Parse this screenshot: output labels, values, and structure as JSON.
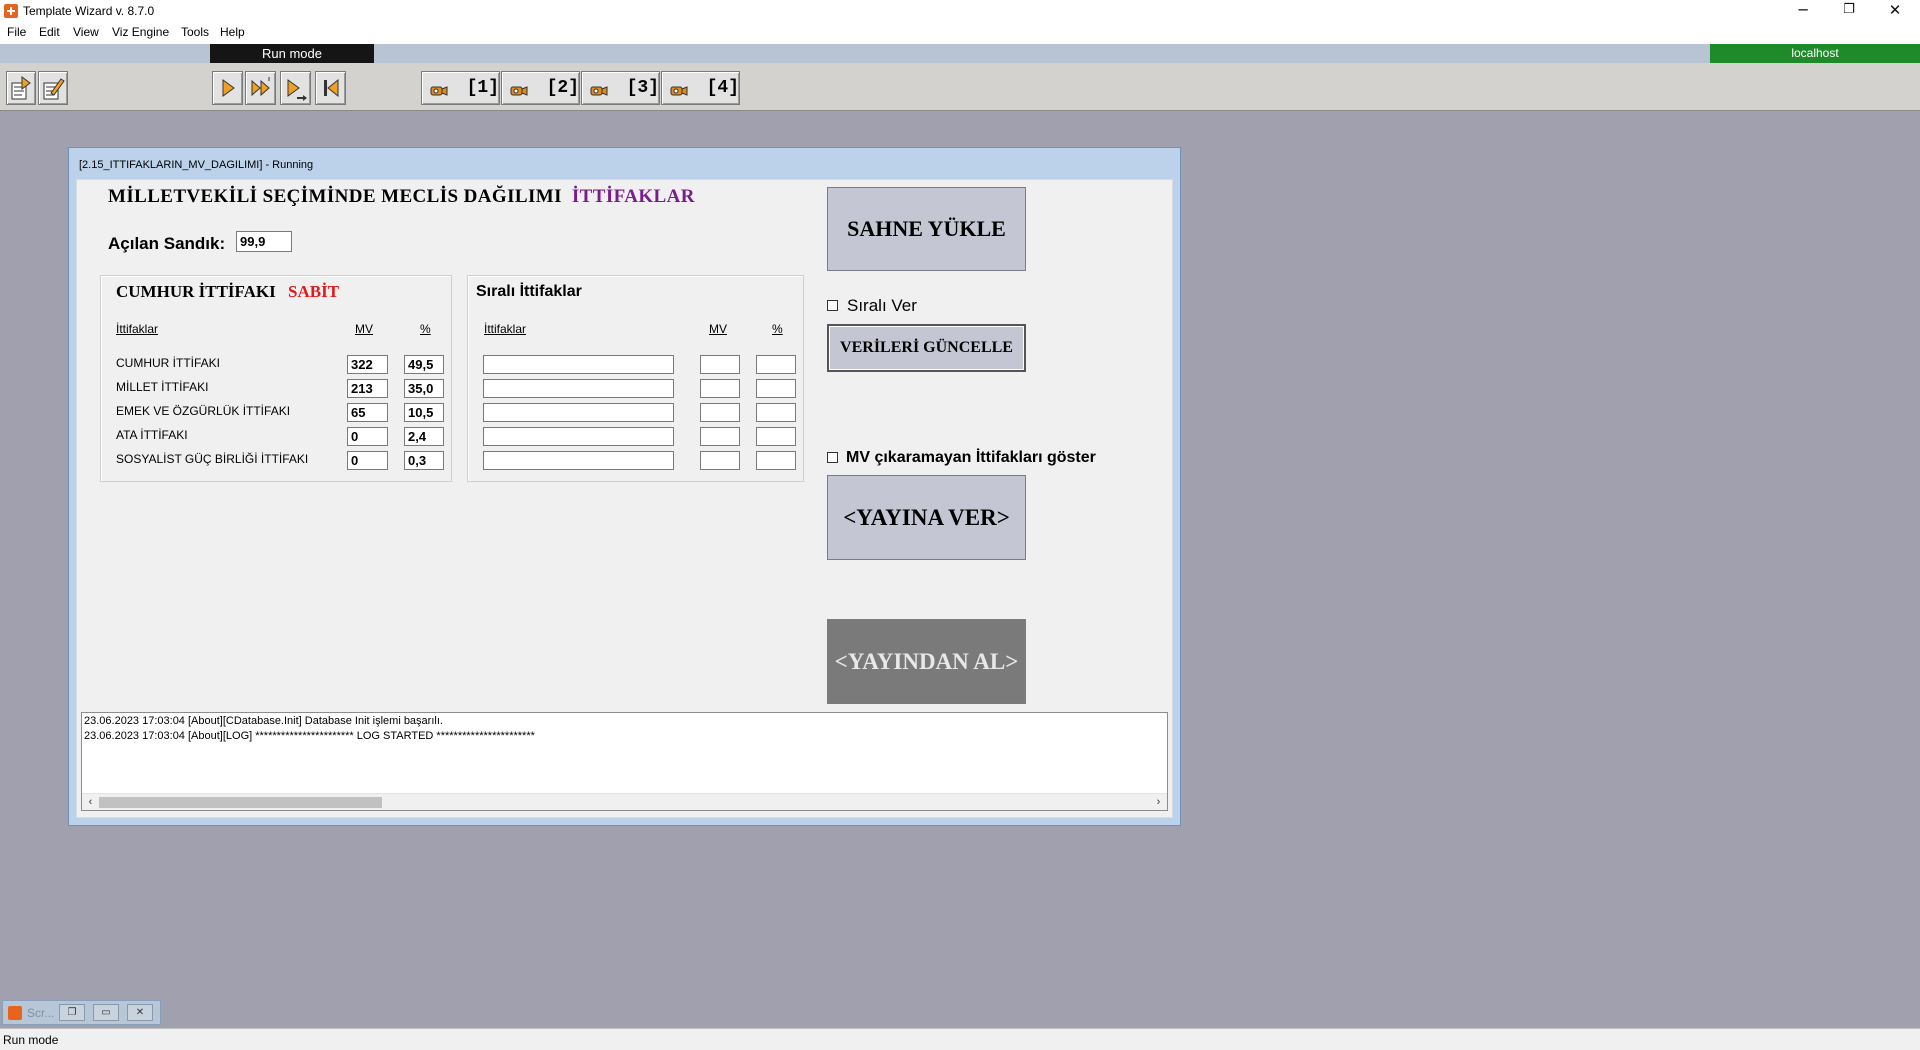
{
  "app": {
    "title": "Template Wizard v. 8.7.0"
  },
  "menu": [
    "File",
    "Edit",
    "View",
    "Viz Engine",
    "Tools",
    "Help"
  ],
  "status_strip": {
    "mode": "Run mode",
    "host": "localhost"
  },
  "toolbar": {
    "camera_buttons": [
      "[1]",
      "[2]",
      "[3]",
      "[4]"
    ]
  },
  "inner_window": {
    "title": "[2.15_ITTIFAKLARIN_MV_DAGILIMI] - Running",
    "main_title": "MİLLETVEKİLİ SEÇİMİNDE MECLİS DAĞILIMI",
    "main_title_accent": "İTTİFAKLAR",
    "acilan_sandik_label": "Açılan Sandık:",
    "acilan_sandik_value": "99,9",
    "group1": {
      "title": "CUMHUR İTTİFAKI",
      "tag": "SABİT",
      "col_name": "İttifaklar",
      "col_mv": "MV",
      "col_pct": "%",
      "rows": [
        {
          "name": "CUMHUR İTTİFAKI",
          "mv": "322",
          "pct": "49,5"
        },
        {
          "name": "MİLLET İTTİFAKI",
          "mv": "213",
          "pct": "35,0"
        },
        {
          "name": "EMEK VE ÖZGÜRLÜK İTTİFAKI",
          "mv": "65",
          "pct": "10,5"
        },
        {
          "name": "ATA İTTİFAKI",
          "mv": "0",
          "pct": "2,4"
        },
        {
          "name": "SOSYALİST GÜÇ BİRLİĞİ İTTİFAKI",
          "mv": "0",
          "pct": "0,3"
        }
      ]
    },
    "group2": {
      "title": "Sıralı İttifaklar",
      "col_name": "İttifaklar",
      "col_mv": "MV",
      "col_pct": "%"
    },
    "sahne_yukle": "SAHNE YÜKLE",
    "sirali_ver": "Sıralı Ver",
    "verileri_guncelle": "VERİLERİ GÜNCELLE",
    "mv_cikaramayan": "MV çıkaramayan İttifakları göster",
    "yayina_ver": "<YAYINA VER>",
    "yayindan_al": "<YAYINDAN AL>",
    "log_lines": [
      "23.06.2023 17:03:04 [About][CDatabase.Init] Database Init işlemi başarılı.",
      "23.06.2023 17:03:04 [About][LOG] *********************** LOG STARTED ***********************"
    ]
  },
  "minimized_window": {
    "label": "Scr..."
  },
  "statusbar": {
    "text": "Run mode"
  }
}
